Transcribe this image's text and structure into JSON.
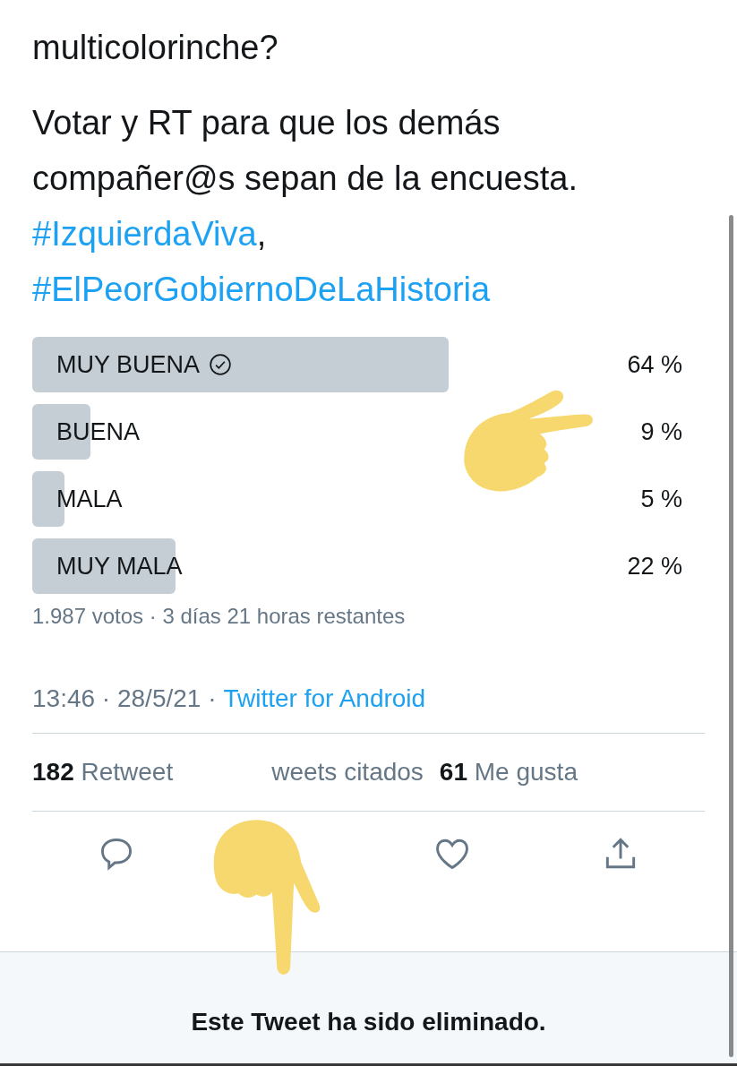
{
  "tweet": {
    "text_lines": [
      "multicolorinche?"
    ],
    "paragraph": "Votar y RT para que los demás compañer@s sepan de la encuesta.",
    "hashtags": [
      {
        "tag": "#IzquierdaViva",
        "suffix": ","
      },
      {
        "tag": "#ElPeorGobiernoDeLaHistoria"
      }
    ]
  },
  "poll": {
    "options": [
      {
        "label": "MUY BUENA",
        "percent": "64 %",
        "winner": true
      },
      {
        "label": "BUENA",
        "percent": "9 %",
        "winner": false
      },
      {
        "label": "MALA",
        "percent": "5 %",
        "winner": false
      },
      {
        "label": "MUY MALA",
        "percent": "22 %",
        "winner": false
      }
    ],
    "summary": "1.987 votos · 3 días 21 horas restantes"
  },
  "meta": {
    "time": "13:46 · 28/5/21 ·",
    "source": "Twitter for Android"
  },
  "stats": [
    {
      "count": "182",
      "label": "Retweet"
    },
    {
      "label": "weets citados"
    },
    {
      "count": "61",
      "label": "Me gusta"
    }
  ],
  "actions": [
    {
      "kind": "reply"
    },
    {
      "kind": "hidden"
    },
    {
      "kind": "like"
    },
    {
      "kind": "share"
    }
  ],
  "notice": "Este Tweet ha sido eliminado."
}
